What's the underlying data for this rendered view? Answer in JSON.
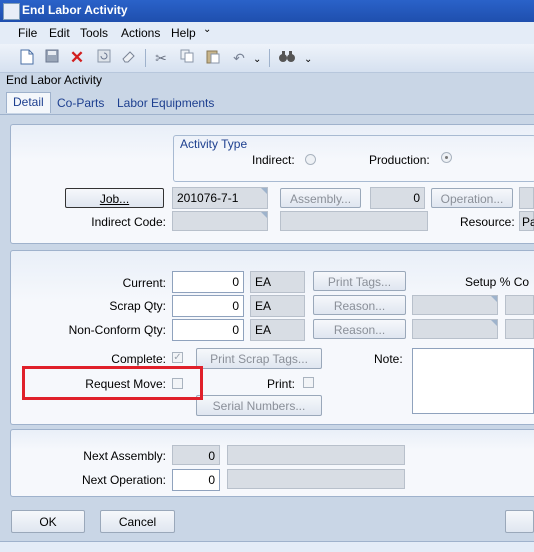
{
  "window": {
    "title": "End Labor Activity"
  },
  "menu": [
    "File",
    "Edit",
    "Tools",
    "Actions",
    "Help"
  ],
  "toolbar": {
    "dropdown_arrow": "⌄"
  },
  "form": {
    "caption": "End Labor Activity"
  },
  "tabs": [
    "Detail",
    "Co-Parts",
    "Labor Equipments"
  ],
  "activity_type": {
    "label": "Activity Type",
    "indirect_label": "Indirect:",
    "production_label": "Production:",
    "selected": "Production"
  },
  "job": {
    "button": "Job...",
    "value": "201076-7-1"
  },
  "assembly": {
    "button": "Assembly...",
    "value": "0"
  },
  "operation": {
    "button": "Operation..."
  },
  "indirect_code": {
    "label": "Indirect Code:"
  },
  "resource": {
    "label": "Resource:",
    "value": "Pa"
  },
  "quantities": {
    "current": {
      "label": "Current:",
      "value": "0",
      "uom": "EA"
    },
    "scrap": {
      "label": "Scrap Qty:",
      "value": "0",
      "uom": "EA"
    },
    "nonconform": {
      "label": "Non-Conform Qty:",
      "value": "0",
      "uom": "EA"
    }
  },
  "buttons": {
    "print_tags": "Print Tags...",
    "reason1": "Reason...",
    "reason2": "Reason...",
    "print_scrap_tags": "Print Scrap Tags...",
    "serial_numbers": "Serial Numbers...",
    "ok": "OK",
    "cancel": "Cancel"
  },
  "setup_label": "Setup % Co",
  "complete": {
    "label": "Complete:",
    "checked": true
  },
  "request_move": {
    "label": "Request Move:",
    "checked": false
  },
  "print": {
    "label": "Print:",
    "checked": false
  },
  "note": {
    "label": "Note:",
    "value": ""
  },
  "next": {
    "assembly_label": "Next Assembly:",
    "assembly_value": "0",
    "operation_label": "Next Operation:",
    "operation_value": "0"
  },
  "colors": {
    "highlight": "#e0202a",
    "titlebar": "#2a62c9"
  }
}
